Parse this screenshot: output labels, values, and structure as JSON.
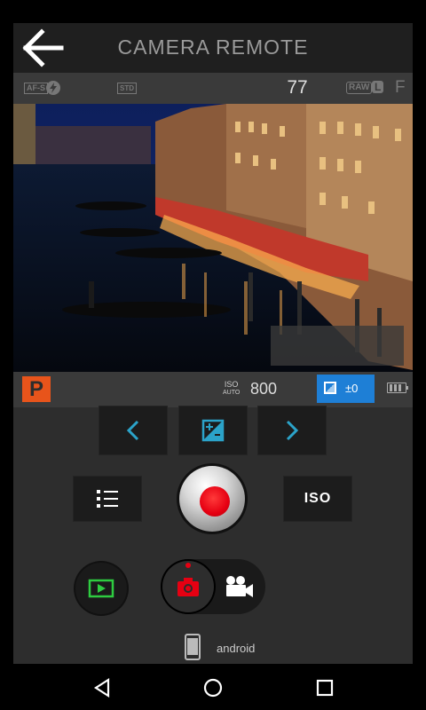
{
  "header": {
    "title": "CAMERA REMOTE",
    "back_icon": "arrow-left-icon"
  },
  "info_bar": {
    "focus_mode": "AF-S",
    "flash_icon": "flash-icon",
    "film_sim": "STD",
    "shots_remaining": "77",
    "format": "RAW",
    "image_size": "L",
    "quality": "F"
  },
  "preview": {
    "description_icon": "live-view-image"
  },
  "status_bar": {
    "mode": "P",
    "iso_label_top": "ISO",
    "iso_label_bottom": "AUTO",
    "iso_value": "800",
    "ev_value": "±0",
    "ev_icon": "exposure-compensation-icon",
    "battery_icon": "battery-icon",
    "colors": {
      "mode": "#e8541b",
      "ev_highlight": "#1e7fd6"
    }
  },
  "controls": {
    "prev_icon": "chevron-left-icon",
    "exposure_icon": "exposure-compensation-icon",
    "next_icon": "chevron-right-icon",
    "menu_icon": "list-icon",
    "iso_button_label": "ISO",
    "shutter_icon": "shutter-button",
    "playback_icon": "playback-icon",
    "photo_icon": "camera-icon",
    "video_icon": "video-camera-icon",
    "colors": {
      "accent": "#2ba3c9",
      "shutter": "#e60012",
      "playback": "#2ecc40"
    }
  },
  "device": {
    "name": "android",
    "icon": "phone-icon"
  },
  "nav": {
    "back_icon": "nav-back-icon",
    "home_icon": "nav-home-icon",
    "recents_icon": "nav-recents-icon"
  }
}
